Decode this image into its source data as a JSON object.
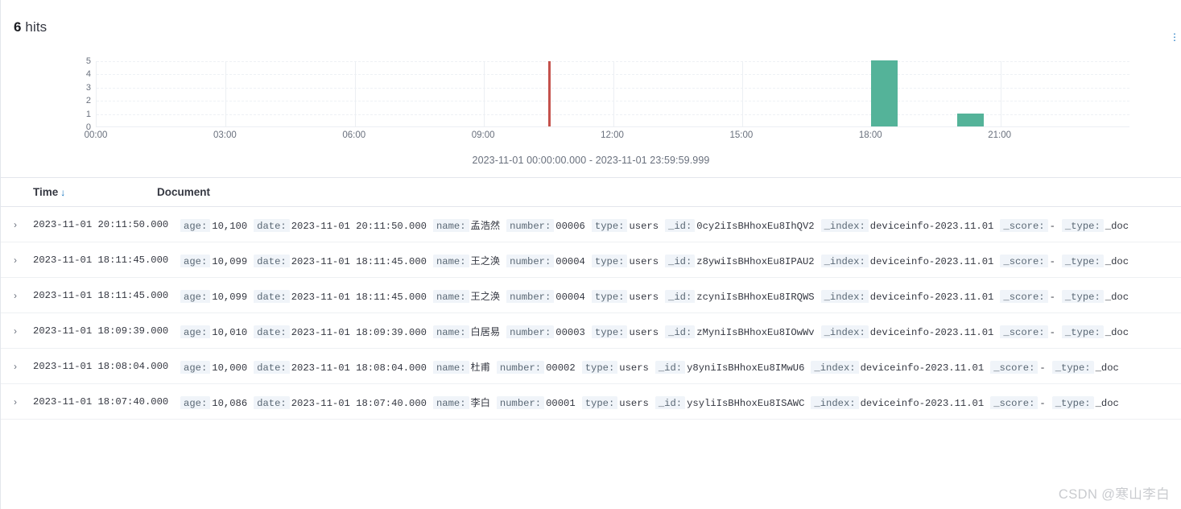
{
  "header": {
    "count": "6",
    "hits_label": "hits",
    "options_icon": "vertical-dots-icon"
  },
  "chart_data": {
    "type": "bar",
    "title": "",
    "xlabel": "",
    "ylabel": "",
    "ylim": [
      0,
      5
    ],
    "ytick_labels": [
      "5",
      "4",
      "3",
      "2",
      "1",
      "0"
    ],
    "xtick_labels": [
      "00:00",
      "03:00",
      "06:00",
      "09:00",
      "12:00",
      "15:00",
      "18:00",
      "21:00"
    ],
    "grid": true,
    "bar_color": "#54b399",
    "marker_color": "#c4524c",
    "categories": [
      "18:00",
      "20:00"
    ],
    "values": [
      5,
      1
    ],
    "series": [
      {
        "name": "hits",
        "values": [
          5,
          1
        ]
      }
    ],
    "annotations": [
      {
        "type": "vline",
        "time": "10:30",
        "color": "#c4524c"
      }
    ],
    "time_range": "2023-11-01 00:00:00.000 - 2023-11-01 23:59:59.999"
  },
  "table": {
    "columns": [
      {
        "key": "time",
        "label": "Time",
        "sort_icon": "arrow-down-icon"
      },
      {
        "key": "document",
        "label": "Document"
      }
    ],
    "expander_icon": "chevron-right-icon",
    "rows": [
      {
        "time": "2023-11-01 20:11:50.000",
        "fields": [
          {
            "name": "age:",
            "value": "10,100"
          },
          {
            "name": "date:",
            "value": "2023-11-01 20:11:50.000"
          },
          {
            "name": "name:",
            "value": "孟浩然"
          },
          {
            "name": "number:",
            "value": "00006"
          },
          {
            "name": "type:",
            "value": "users"
          },
          {
            "name": "_id:",
            "value": "0cy2iIsBHhoxEu8IhQV2"
          },
          {
            "name": "_index:",
            "value": "deviceinfo-2023.11.01"
          },
          {
            "name": "_score:",
            "value": "-"
          },
          {
            "name": "_type:",
            "value": "_doc"
          }
        ]
      },
      {
        "time": "2023-11-01 18:11:45.000",
        "fields": [
          {
            "name": "age:",
            "value": "10,099"
          },
          {
            "name": "date:",
            "value": "2023-11-01 18:11:45.000"
          },
          {
            "name": "name:",
            "value": "王之涣"
          },
          {
            "name": "number:",
            "value": "00004"
          },
          {
            "name": "type:",
            "value": "users"
          },
          {
            "name": "_id:",
            "value": "z8ywiIsBHhoxEu8IPAU2"
          },
          {
            "name": "_index:",
            "value": "deviceinfo-2023.11.01"
          },
          {
            "name": "_score:",
            "value": "-"
          },
          {
            "name": "_type:",
            "value": "_doc"
          }
        ]
      },
      {
        "time": "2023-11-01 18:11:45.000",
        "fields": [
          {
            "name": "age:",
            "value": "10,099"
          },
          {
            "name": "date:",
            "value": "2023-11-01 18:11:45.000"
          },
          {
            "name": "name:",
            "value": "王之涣"
          },
          {
            "name": "number:",
            "value": "00004"
          },
          {
            "name": "type:",
            "value": "users"
          },
          {
            "name": "_id:",
            "value": "zcyniIsBHhoxEu8IRQWS"
          },
          {
            "name": "_index:",
            "value": "deviceinfo-2023.11.01"
          },
          {
            "name": "_score:",
            "value": "-"
          },
          {
            "name": "_type:",
            "value": "_doc"
          }
        ]
      },
      {
        "time": "2023-11-01 18:09:39.000",
        "fields": [
          {
            "name": "age:",
            "value": "10,010"
          },
          {
            "name": "date:",
            "value": "2023-11-01 18:09:39.000"
          },
          {
            "name": "name:",
            "value": "白居易"
          },
          {
            "name": "number:",
            "value": "00003"
          },
          {
            "name": "type:",
            "value": "users"
          },
          {
            "name": "_id:",
            "value": "zMyniIsBHhoxEu8IOwWv"
          },
          {
            "name": "_index:",
            "value": "deviceinfo-2023.11.01"
          },
          {
            "name": "_score:",
            "value": "-"
          },
          {
            "name": "_type:",
            "value": "_doc"
          }
        ]
      },
      {
        "time": "2023-11-01 18:08:04.000",
        "fields": [
          {
            "name": "age:",
            "value": "10,000"
          },
          {
            "name": "date:",
            "value": "2023-11-01 18:08:04.000"
          },
          {
            "name": "name:",
            "value": "杜甫"
          },
          {
            "name": "number:",
            "value": "00002"
          },
          {
            "name": "type:",
            "value": "users"
          },
          {
            "name": "_id:",
            "value": "y8yniIsBHhoxEu8IMwU6"
          },
          {
            "name": "_index:",
            "value": "deviceinfo-2023.11.01"
          },
          {
            "name": "_score:",
            "value": "-"
          },
          {
            "name": "_type:",
            "value": "_doc"
          }
        ]
      },
      {
        "time": "2023-11-01 18:07:40.000",
        "fields": [
          {
            "name": "age:",
            "value": "10,086"
          },
          {
            "name": "date:",
            "value": "2023-11-01 18:07:40.000"
          },
          {
            "name": "name:",
            "value": "李白"
          },
          {
            "name": "number:",
            "value": "00001"
          },
          {
            "name": "type:",
            "value": "users"
          },
          {
            "name": "_id:",
            "value": "ysyliIsBHhoxEu8ISAWC"
          },
          {
            "name": "_index:",
            "value": "deviceinfo-2023.11.01"
          },
          {
            "name": "_score:",
            "value": "-"
          },
          {
            "name": "_type:",
            "value": "_doc"
          }
        ]
      }
    ]
  },
  "watermark": "CSDN @寒山李白"
}
